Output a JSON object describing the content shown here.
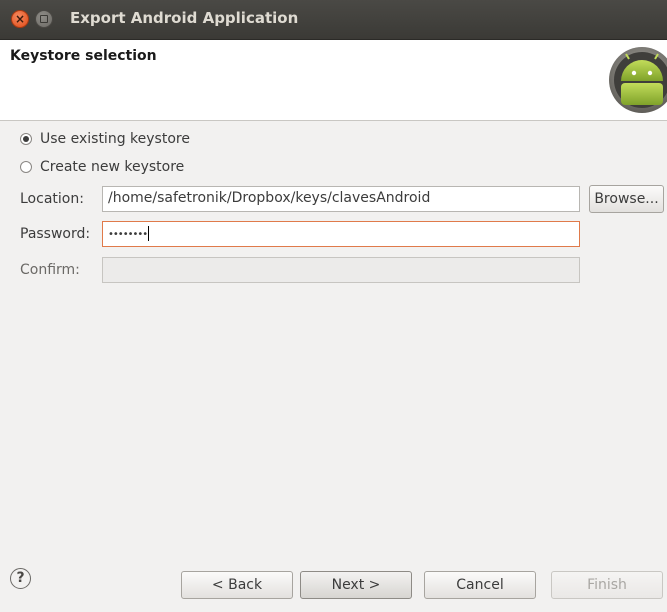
{
  "window": {
    "title": "Export Android Application"
  },
  "banner": {
    "title": "Keystore selection"
  },
  "options": {
    "use_existing": "Use existing keystore",
    "create_new": "Create new keystore",
    "selected": "use_existing"
  },
  "fields": {
    "location_label": "Location:",
    "location_value": "/home/safetronik/Dropbox/keys/clavesAndroid",
    "browse_label": "Browse...",
    "password_label": "Password:",
    "password_mask": "••••••••",
    "confirm_label": "Confirm:",
    "confirm_value": ""
  },
  "buttons": {
    "help": "?",
    "back": "< Back",
    "next": "Next >",
    "cancel": "Cancel",
    "finish": "Finish"
  },
  "colors": {
    "titlebar": "#3b3a36",
    "close_button": "#df4a16",
    "android_green": "#9fbf3b",
    "dialog_background": "#f2f1f0",
    "focus_border": "#e07a4a"
  }
}
